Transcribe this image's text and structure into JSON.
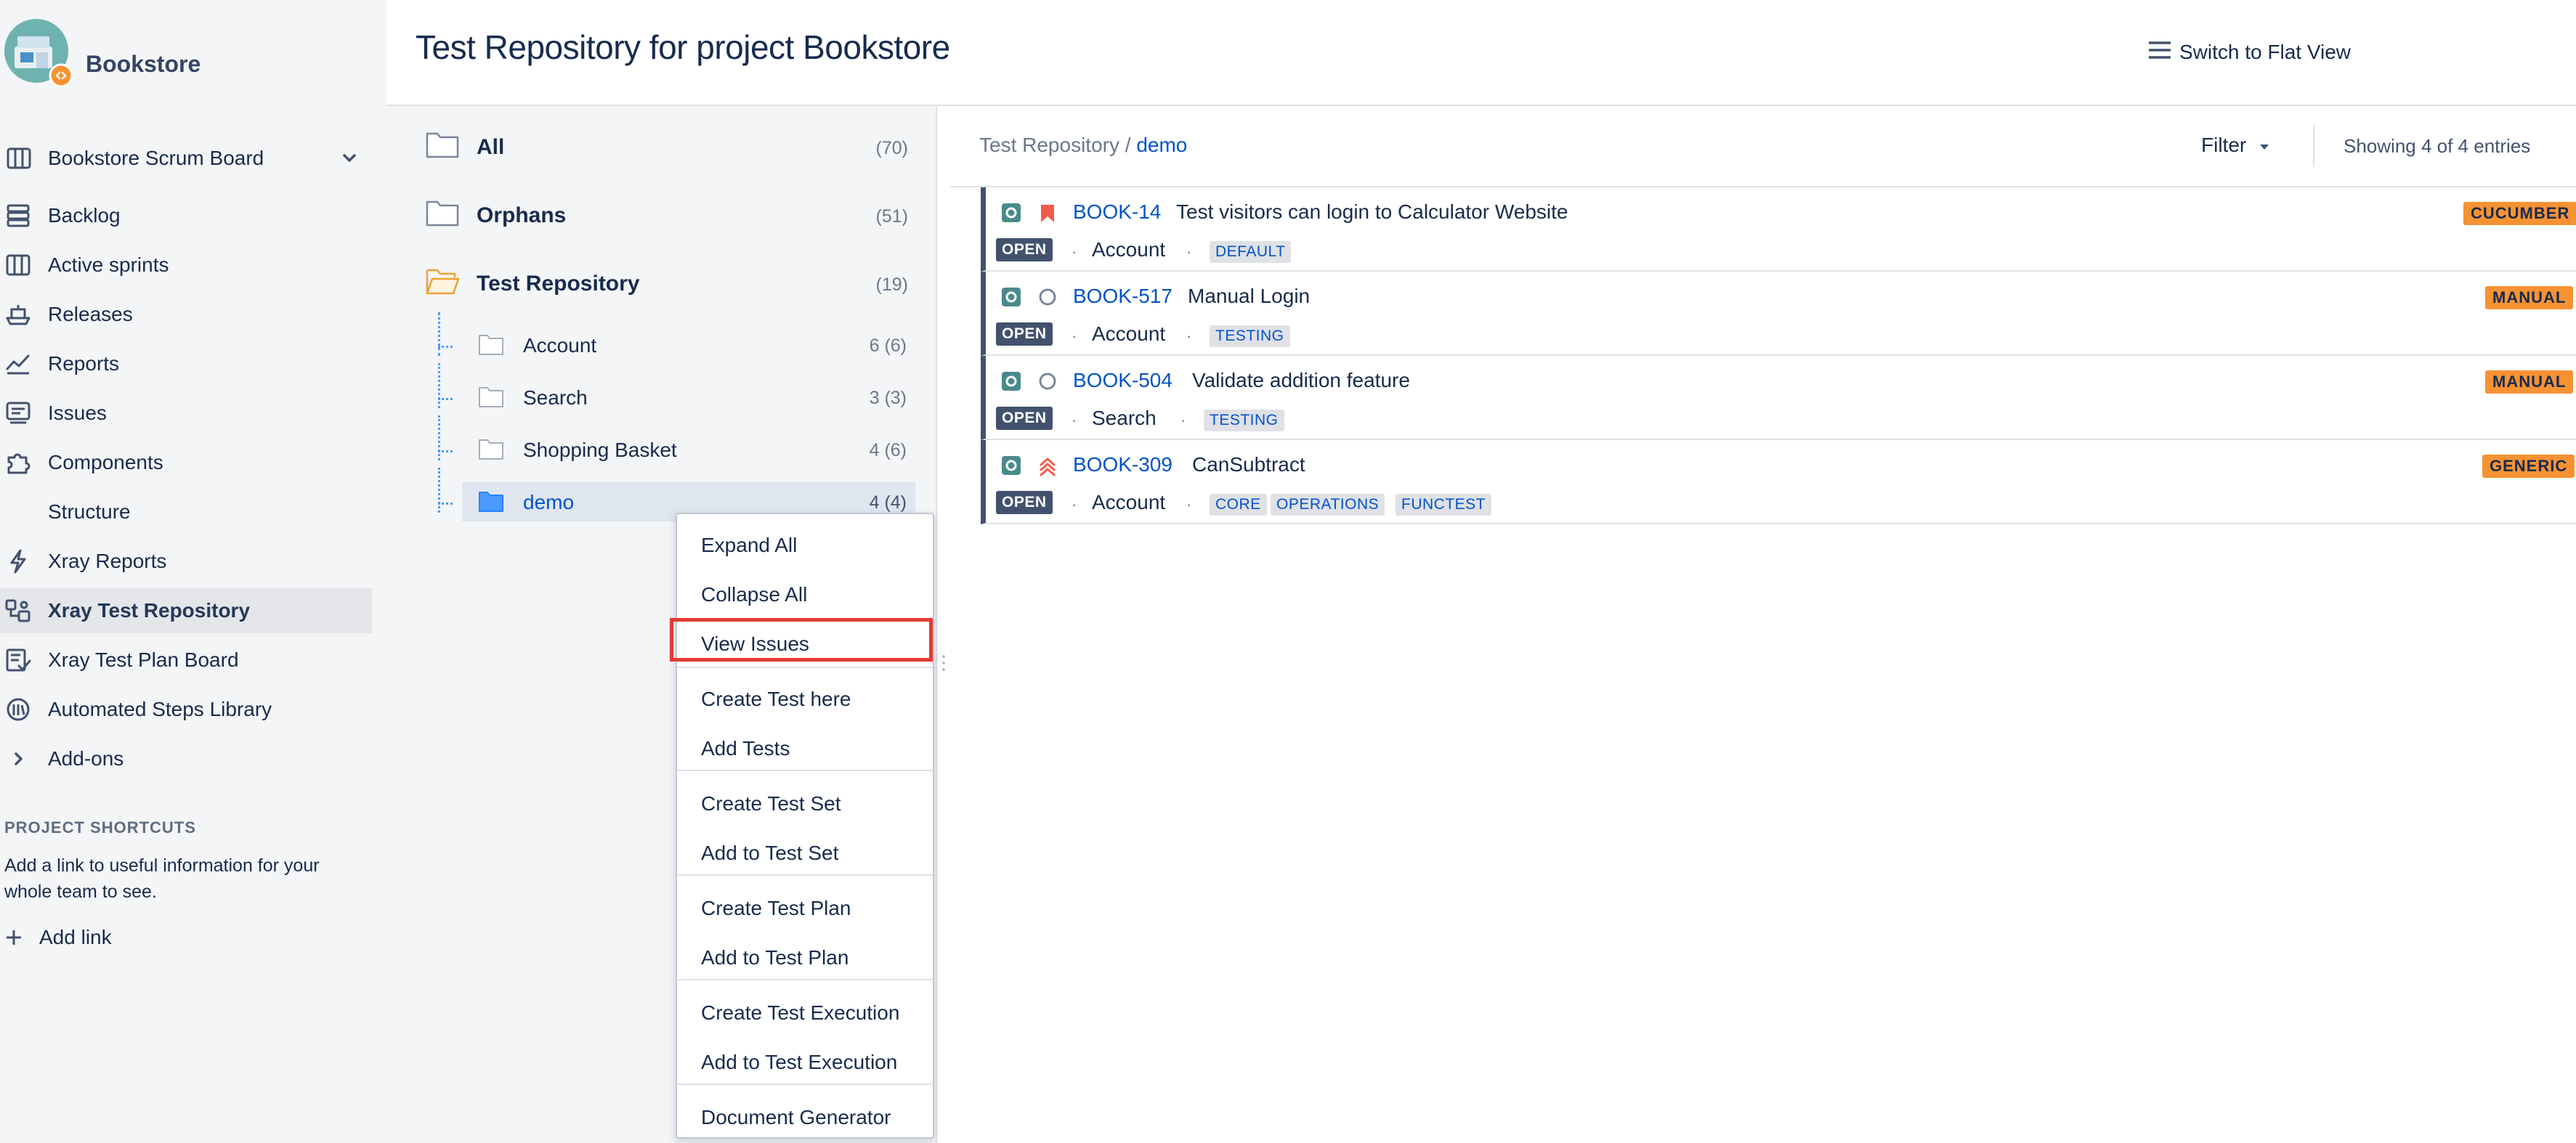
{
  "sidebar": {
    "project_name": "Bookstore",
    "board_selector": "Bookstore Scrum Board",
    "items": [
      {
        "label": "Backlog",
        "icon": "backlog-icon"
      },
      {
        "label": "Active sprints",
        "icon": "board-icon"
      },
      {
        "label": "Releases",
        "icon": "ship-icon"
      },
      {
        "label": "Reports",
        "icon": "chart-icon"
      },
      {
        "label": "Issues",
        "icon": "issues-icon"
      },
      {
        "label": "Components",
        "icon": "puzzle-icon"
      },
      {
        "label": "Structure",
        "icon": ""
      },
      {
        "label": "Xray Reports",
        "icon": "bolt-icon"
      },
      {
        "label": "Xray Test Repository",
        "icon": "repository-icon",
        "active": true
      },
      {
        "label": "Xray Test Plan Board",
        "icon": "plan-board-icon"
      },
      {
        "label": "Automated Steps Library",
        "icon": "library-icon"
      },
      {
        "label": "Add-ons",
        "icon": "chevron-right-icon"
      }
    ],
    "shortcuts_heading": "PROJECT SHORTCUTS",
    "shortcuts_desc": "Add a link to useful information for your whole team to see.",
    "add_link": "Add link"
  },
  "header": {
    "title": "Test Repository for project Bookstore",
    "flat_view": "Switch to Flat View"
  },
  "tree": {
    "roots": [
      {
        "label": "All",
        "count": "(70)"
      },
      {
        "label": "Orphans",
        "count": "(51)"
      },
      {
        "label": "Test Repository",
        "count": "(19)"
      }
    ],
    "children": [
      {
        "label": "Account",
        "count": "6 (6)"
      },
      {
        "label": "Search",
        "count": "3 (3)"
      },
      {
        "label": "Shopping Basket",
        "count": "4 (6)"
      },
      {
        "label": "demo",
        "count": "4 (4)",
        "selected": true
      }
    ]
  },
  "context_menu": {
    "items": [
      "Expand All",
      "Collapse All",
      "View Issues",
      "Create Test here",
      "Add Tests",
      "Create Test Set",
      "Add to Test Set",
      "Create Test Plan",
      "Add to Test Plan",
      "Create Test Execution",
      "Add to Test Execution",
      "Document Generator"
    ],
    "highlighted": "View Issues"
  },
  "issues_panel": {
    "breadcrumb_root": "Test Repository",
    "breadcrumb_sep": " / ",
    "breadcrumb_current": "demo",
    "filter": "Filter",
    "showing": "Showing 4 of 4 entries",
    "separator_dot": "·",
    "issues": [
      {
        "key": "BOOK-14",
        "summary": "Test visitors can login to Calculator Website",
        "status": "OPEN",
        "folder": "Account",
        "labels": [
          "DEFAULT"
        ],
        "test_type": "CUCUMBER",
        "priority_icon": "priority-highest-icon"
      },
      {
        "key": "BOOK-517",
        "summary": "Manual Login",
        "status": "OPEN",
        "folder": "Account",
        "labels": [
          "TESTING"
        ],
        "test_type": "MANUAL",
        "priority_icon": "priority-none-icon"
      },
      {
        "key": "BOOK-504",
        "summary": "Validate addition feature",
        "status": "OPEN",
        "folder": "Search",
        "labels": [
          "TESTING"
        ],
        "test_type": "MANUAL",
        "priority_icon": "priority-none-icon"
      },
      {
        "key": "BOOK-309",
        "summary": "CanSubtract",
        "status": "OPEN",
        "folder": "Account",
        "labels": [
          "CORE",
          "OPERATIONS",
          "FUNCTEST"
        ],
        "test_type": "GENERIC",
        "priority_icon": "priority-high-icon"
      }
    ]
  },
  "colors": {
    "link": "#0052cc",
    "status_badge": "#42526e",
    "test_type_badge": "#f79233",
    "highlight_border": "#e53935",
    "sidebar_bg": "#f4f5f7"
  }
}
